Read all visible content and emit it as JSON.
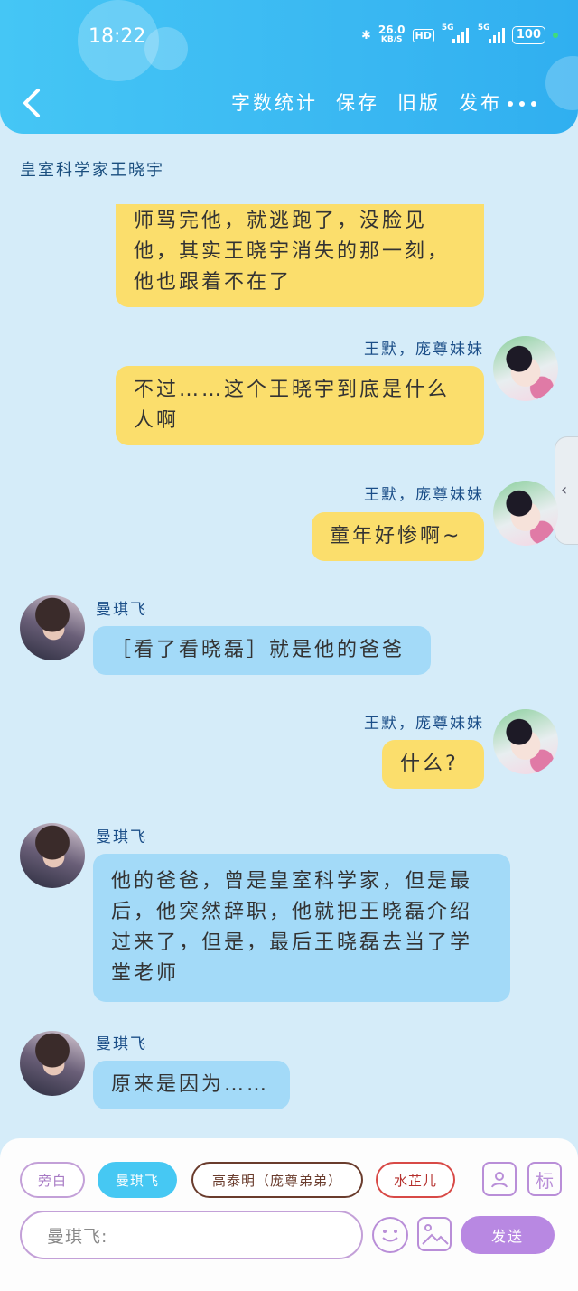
{
  "status_bar": {
    "time": "18:22",
    "net_speed": "26.0",
    "net_unit": "KB/S",
    "hd": "HD",
    "sig1_tag": "5G",
    "sig2_tag": "5G",
    "battery": "100"
  },
  "header": {
    "menu": [
      "字数统计",
      "保存",
      "旧版",
      "发布"
    ]
  },
  "chat_title": "皇室科学家王晓宇",
  "messages": [
    {
      "speaker": "",
      "text": "师骂完他，就逃跑了，没脸见他，其实王晓宇消失的那一刻，他也跟着不在了"
    },
    {
      "speaker": "王默，庞尊妹妹",
      "text": "不过……这个王晓宇到底是什么人啊"
    },
    {
      "speaker": "王默，庞尊妹妹",
      "text": "童年好惨啊~"
    },
    {
      "speaker": "曼琪飞",
      "text": "［看了看晓磊］就是他的爸爸"
    },
    {
      "speaker": "王默，庞尊妹妹",
      "text": "什么?"
    },
    {
      "speaker": "曼琪飞",
      "text": "他的爸爸，曾是皇室科学家，但是最后，他突然辞职，他就把王晓磊介绍过来了，但是，最后王晓磊去当了学堂老师"
    },
    {
      "speaker": "曼琪飞",
      "text": "原来是因为……"
    }
  ],
  "bottom": {
    "roles": [
      "旁白",
      "曼琪飞",
      "高泰明（庞尊弟弟）",
      "水芷儿"
    ],
    "tool_icons": {
      "profile": "profile-icon",
      "tag": "标"
    },
    "input_placeholder": "曼琪飞:",
    "send_label": "发送"
  },
  "colors": {
    "header": "#3ab8f2",
    "bg": "#d5ecf9",
    "yellow_bubble": "#fbde6c",
    "blue_bubble": "#a3daf8",
    "send": "#b888e2"
  }
}
